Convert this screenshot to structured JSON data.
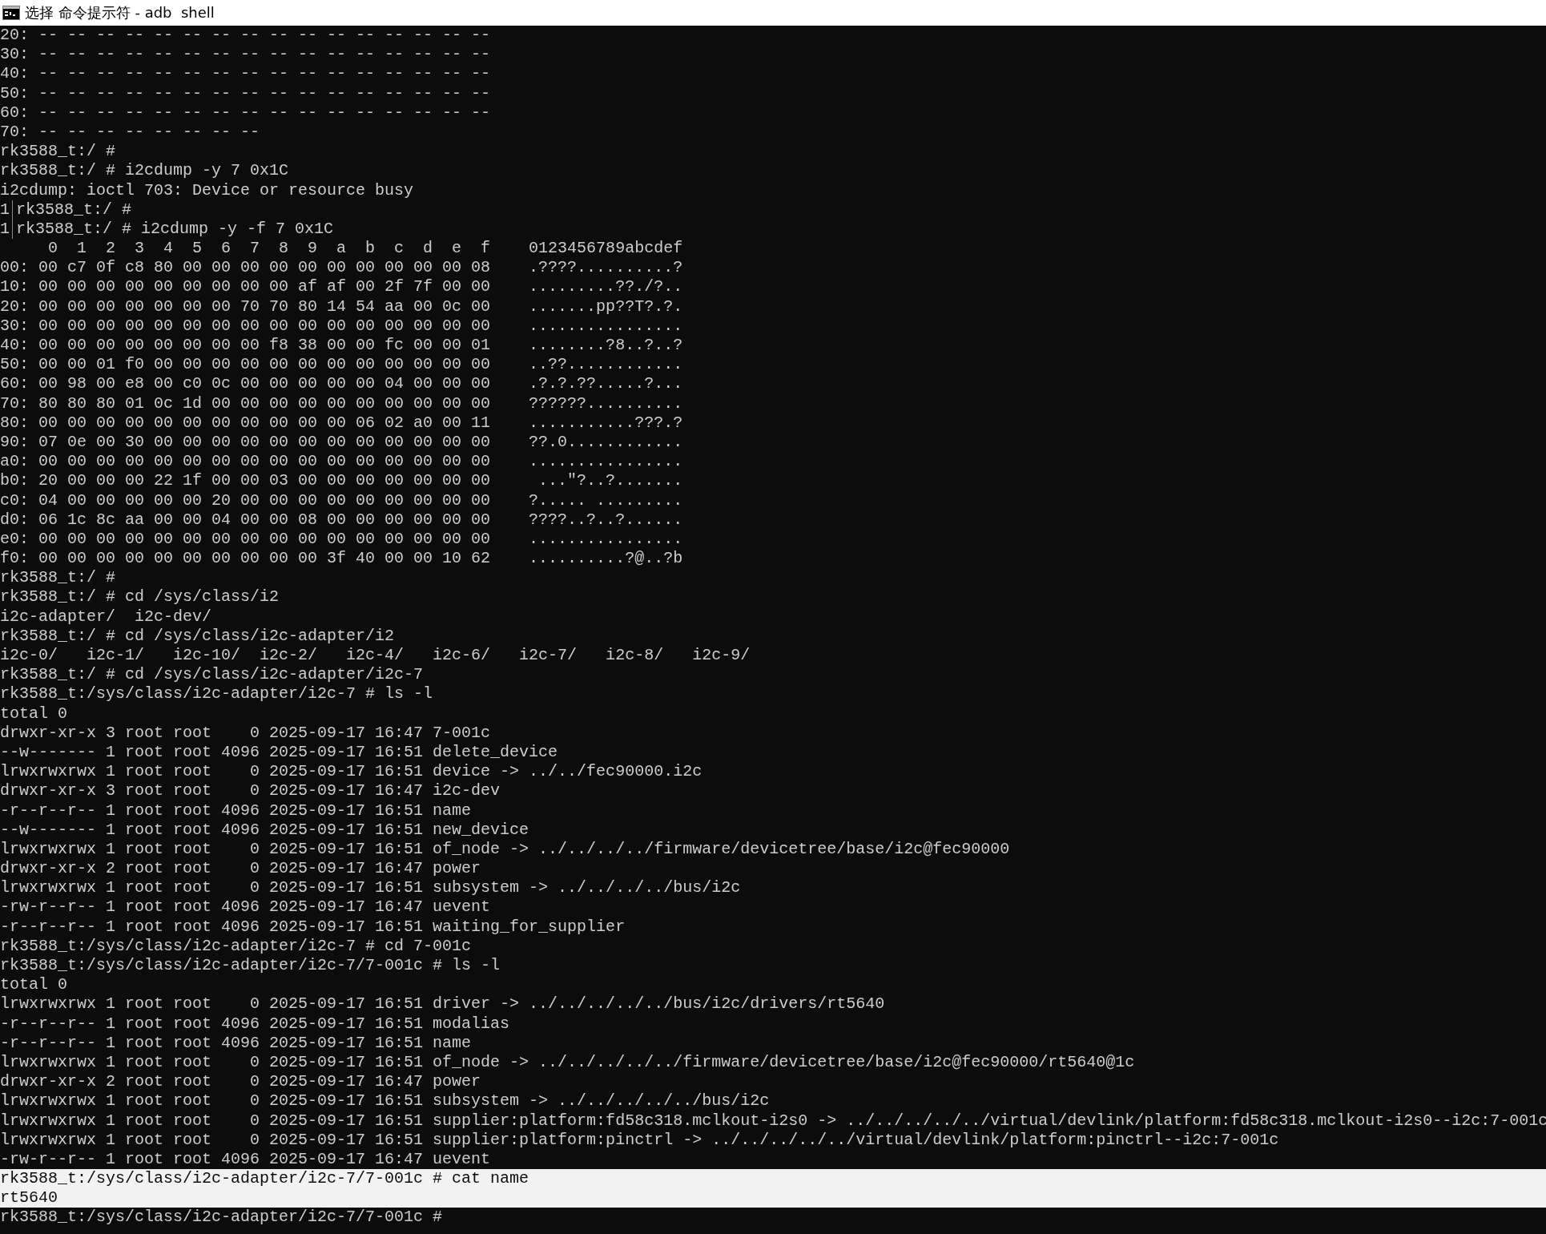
{
  "window": {
    "title": "选择 命令提示符 - adb  shell"
  },
  "lines": [
    {
      "text": "20: -- -- -- -- -- -- -- -- -- -- -- -- -- -- -- --",
      "selected": false
    },
    {
      "text": "30: -- -- -- -- -- -- -- -- -- -- -- -- -- -- -- --",
      "selected": false
    },
    {
      "text": "40: -- -- -- -- -- -- -- -- -- -- -- -- -- -- -- --",
      "selected": false
    },
    {
      "text": "50: -- -- -- -- -- -- -- -- -- -- -- -- -- -- -- --",
      "selected": false
    },
    {
      "text": "60: -- -- -- -- -- -- -- -- -- -- -- -- -- -- -- --",
      "selected": false
    },
    {
      "text": "70: -- -- -- -- -- -- -- --",
      "selected": false
    },
    {
      "text": "rk3588_t:/ #",
      "selected": false
    },
    {
      "text": "rk3588_t:/ # i2cdump -y 7 0x1C",
      "selected": false
    },
    {
      "text": "i2cdump: ioctl 703: Device or resource busy",
      "selected": false
    },
    {
      "marker": "1",
      "text": "rk3588_t:/ #",
      "selected": false
    },
    {
      "marker": "1",
      "text": "rk3588_t:/ # i2cdump -y -f 7 0x1C",
      "selected": false
    },
    {
      "text": "     0  1  2  3  4  5  6  7  8  9  a  b  c  d  e  f    0123456789abcdef",
      "selected": false
    },
    {
      "text": "00: 00 c7 0f c8 80 00 00 00 00 00 00 00 00 00 00 08    .????..........?",
      "selected": false
    },
    {
      "text": "10: 00 00 00 00 00 00 00 00 00 af af 00 2f 7f 00 00    .........??./?..",
      "selected": false
    },
    {
      "text": "20: 00 00 00 00 00 00 00 70 70 80 14 54 aa 00 0c 00    .......pp??T?.?.",
      "selected": false
    },
    {
      "text": "30: 00 00 00 00 00 00 00 00 00 00 00 00 00 00 00 00    ................",
      "selected": false
    },
    {
      "text": "40: 00 00 00 00 00 00 00 00 f8 38 00 00 fc 00 00 01    ........?8..?..?",
      "selected": false
    },
    {
      "text": "50: 00 00 01 f0 00 00 00 00 00 00 00 00 00 00 00 00    ..??............",
      "selected": false
    },
    {
      "text": "60: 00 98 00 e8 00 c0 0c 00 00 00 00 00 04 00 00 00    .?.?.??.....?...",
      "selected": false
    },
    {
      "text": "70: 80 80 80 01 0c 1d 00 00 00 00 00 00 00 00 00 00    ??????..........",
      "selected": false
    },
    {
      "text": "80: 00 00 00 00 00 00 00 00 00 00 00 06 02 a0 00 11    ...........???.?",
      "selected": false
    },
    {
      "text": "90: 07 0e 00 30 00 00 00 00 00 00 00 00 00 00 00 00    ??.0............",
      "selected": false
    },
    {
      "text": "a0: 00 00 00 00 00 00 00 00 00 00 00 00 00 00 00 00    ................",
      "selected": false
    },
    {
      "text": "b0: 20 00 00 00 22 1f 00 00 03 00 00 00 00 00 00 00     ...\"?..?.......",
      "selected": false
    },
    {
      "text": "c0: 04 00 00 00 00 00 20 00 00 00 00 00 00 00 00 00    ?..... .........",
      "selected": false
    },
    {
      "text": "d0: 06 1c 8c aa 00 00 04 00 00 08 00 00 00 00 00 00    ????..?..?......",
      "selected": false
    },
    {
      "text": "e0: 00 00 00 00 00 00 00 00 00 00 00 00 00 00 00 00    ................",
      "selected": false
    },
    {
      "text": "f0: 00 00 00 00 00 00 00 00 00 00 3f 40 00 00 10 62    ..........?@..?b",
      "selected": false
    },
    {
      "text": "rk3588_t:/ #",
      "selected": false
    },
    {
      "text": "rk3588_t:/ # cd /sys/class/i2",
      "selected": false
    },
    {
      "text": "i2c-adapter/  i2c-dev/",
      "selected": false
    },
    {
      "text": "rk3588_t:/ # cd /sys/class/i2c-adapter/i2",
      "selected": false
    },
    {
      "text": "i2c-0/   i2c-1/   i2c-10/  i2c-2/   i2c-4/   i2c-6/   i2c-7/   i2c-8/   i2c-9/",
      "selected": false
    },
    {
      "text": "rk3588_t:/ # cd /sys/class/i2c-adapter/i2c-7",
      "selected": false
    },
    {
      "text": "rk3588_t:/sys/class/i2c-adapter/i2c-7 # ls -l",
      "selected": false
    },
    {
      "text": "total 0",
      "selected": false
    },
    {
      "text": "drwxr-xr-x 3 root root    0 2025-09-17 16:47 7-001c",
      "selected": false
    },
    {
      "text": "--w------- 1 root root 4096 2025-09-17 16:51 delete_device",
      "selected": false
    },
    {
      "text": "lrwxrwxrwx 1 root root    0 2025-09-17 16:51 device -> ../../fec90000.i2c",
      "selected": false
    },
    {
      "text": "drwxr-xr-x 3 root root    0 2025-09-17 16:47 i2c-dev",
      "selected": false
    },
    {
      "text": "-r--r--r-- 1 root root 4096 2025-09-17 16:51 name",
      "selected": false
    },
    {
      "text": "--w------- 1 root root 4096 2025-09-17 16:51 new_device",
      "selected": false
    },
    {
      "text": "lrwxrwxrwx 1 root root    0 2025-09-17 16:51 of_node -> ../../../../firmware/devicetree/base/i2c@fec90000",
      "selected": false
    },
    {
      "text": "drwxr-xr-x 2 root root    0 2025-09-17 16:47 power",
      "selected": false
    },
    {
      "text": "lrwxrwxrwx 1 root root    0 2025-09-17 16:51 subsystem -> ../../../../bus/i2c",
      "selected": false
    },
    {
      "text": "-rw-r--r-- 1 root root 4096 2025-09-17 16:47 uevent",
      "selected": false
    },
    {
      "text": "-r--r--r-- 1 root root 4096 2025-09-17 16:51 waiting_for_supplier",
      "selected": false
    },
    {
      "text": "rk3588_t:/sys/class/i2c-adapter/i2c-7 # cd 7-001c",
      "selected": false
    },
    {
      "text": "rk3588_t:/sys/class/i2c-adapter/i2c-7/7-001c # ls -l",
      "selected": false
    },
    {
      "text": "total 0",
      "selected": false
    },
    {
      "text": "lrwxrwxrwx 1 root root    0 2025-09-17 16:51 driver -> ../../../../../bus/i2c/drivers/rt5640",
      "selected": false
    },
    {
      "text": "-r--r--r-- 1 root root 4096 2025-09-17 16:51 modalias",
      "selected": false
    },
    {
      "text": "-r--r--r-- 1 root root 4096 2025-09-17 16:51 name",
      "selected": false
    },
    {
      "text": "lrwxrwxrwx 1 root root    0 2025-09-17 16:51 of_node -> ../../../../../firmware/devicetree/base/i2c@fec90000/rt5640@1c",
      "selected": false
    },
    {
      "text": "drwxr-xr-x 2 root root    0 2025-09-17 16:47 power",
      "selected": false
    },
    {
      "text": "lrwxrwxrwx 1 root root    0 2025-09-17 16:51 subsystem -> ../../../../../bus/i2c",
      "selected": false
    },
    {
      "text": "lrwxrwxrwx 1 root root    0 2025-09-17 16:51 supplier:platform:fd58c318.mclkout-i2s0 -> ../../../../../virtual/devlink/platform:fd58c318.mclkout-i2s0--i2c:7-001c",
      "selected": false
    },
    {
      "text": "lrwxrwxrwx 1 root root    0 2025-09-17 16:51 supplier:platform:pinctrl -> ../../../../../virtual/devlink/platform:pinctrl--i2c:7-001c",
      "selected": false
    },
    {
      "text": "-rw-r--r-- 1 root root 4096 2025-09-17 16:47 uevent",
      "selected": false
    },
    {
      "text": "rk3588_t:/sys/class/i2c-adapter/i2c-7/7-001c # cat name",
      "selected": true
    },
    {
      "text": "rt5640",
      "selected": true
    },
    {
      "text": "rk3588_t:/sys/class/i2c-adapter/i2c-7/7-001c #",
      "selected": false
    }
  ]
}
